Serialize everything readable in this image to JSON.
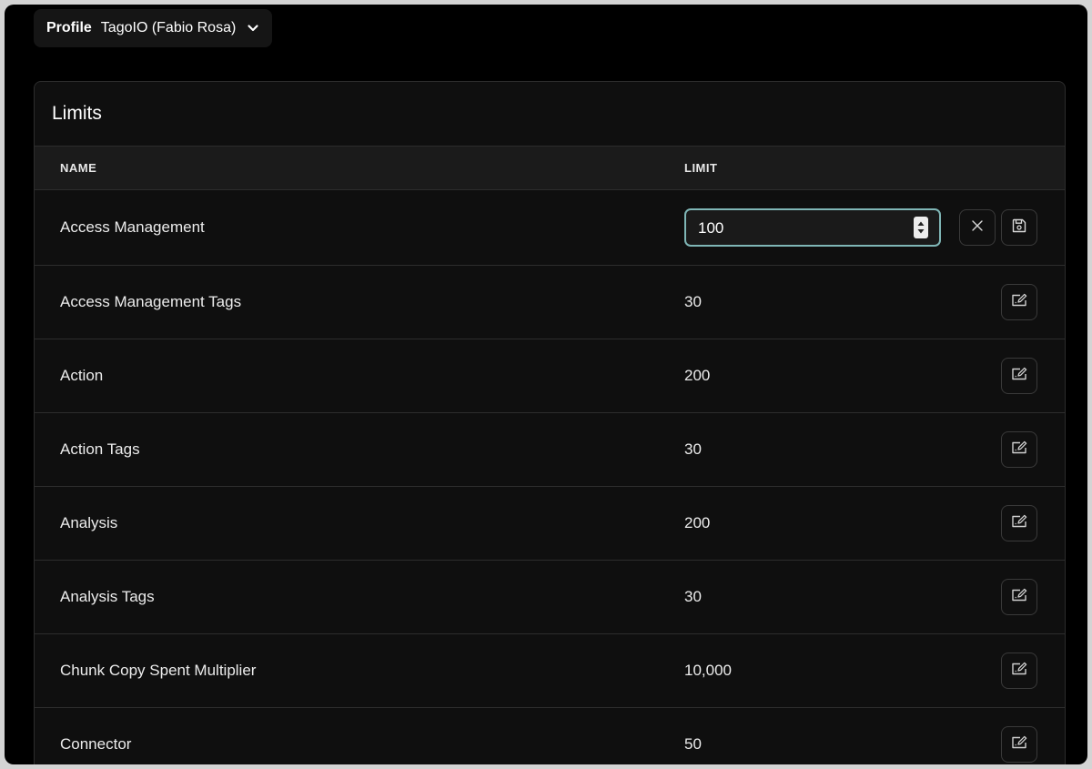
{
  "profile": {
    "label": "Profile",
    "value": "TagoIO (Fabio Rosa)"
  },
  "limits": {
    "title": "Limits",
    "columns": {
      "name": "NAME",
      "limit": "LIMIT"
    },
    "editing_row": {
      "name": "Access Management",
      "input_value": "100"
    },
    "rows": [
      {
        "name": "Access Management Tags",
        "limit": "30"
      },
      {
        "name": "Action",
        "limit": "200"
      },
      {
        "name": "Action Tags",
        "limit": "30"
      },
      {
        "name": "Analysis",
        "limit": "200"
      },
      {
        "name": "Analysis Tags",
        "limit": "30"
      },
      {
        "name": "Chunk Copy Spent Multiplier",
        "limit": "10,000"
      },
      {
        "name": "Connector",
        "limit": "50"
      }
    ]
  },
  "colors": {
    "accent_focus": "#7fb6b6",
    "background": "#000000",
    "card": "#0f0f0f"
  },
  "icons": {
    "profile_dropdown": "chevron-down-icon",
    "cancel": "close-icon",
    "save": "save-icon",
    "edit": "edit-icon"
  }
}
